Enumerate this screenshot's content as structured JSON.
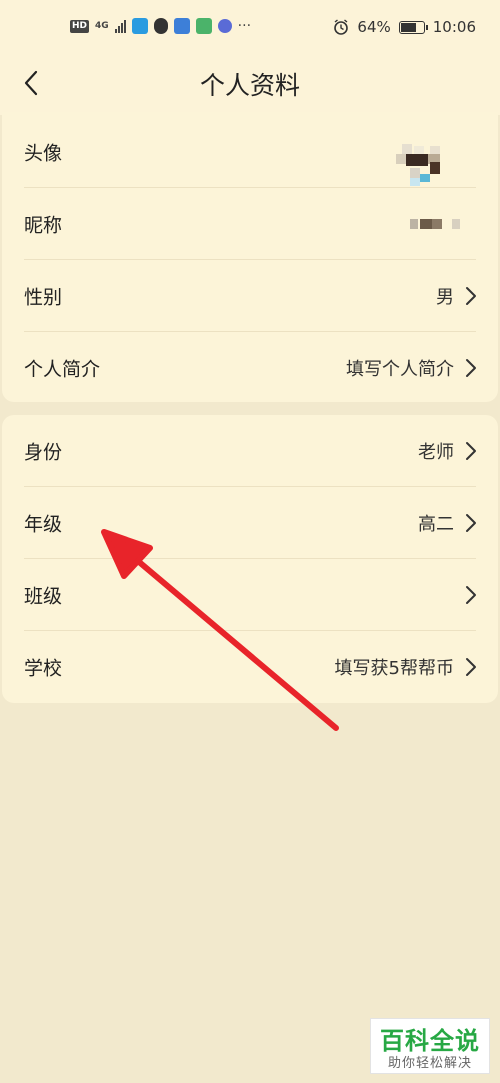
{
  "status_bar": {
    "hd": "HD",
    "network": "4G",
    "battery_pct": "64%",
    "battery_level": 0.64,
    "time": "10:06",
    "more": "···"
  },
  "header": {
    "title": "个人资料"
  },
  "profile_section": {
    "rows": [
      {
        "label": "头像",
        "value": ""
      },
      {
        "label": "昵称",
        "value": ""
      },
      {
        "label": "性别",
        "value": "男"
      },
      {
        "label": "个人简介",
        "value": "填写个人简介"
      }
    ]
  },
  "school_section": {
    "rows": [
      {
        "label": "身份",
        "value": "老师"
      },
      {
        "label": "年级",
        "value": "高二"
      },
      {
        "label": "班级",
        "value": ""
      },
      {
        "label": "学校",
        "value": "填写获5帮帮币"
      }
    ]
  },
  "watermark": {
    "title": "百科全说",
    "subtitle": "助你轻松解决"
  },
  "colors": {
    "background": "#f2e9cd",
    "card": "#fcf4d8",
    "arrow": "#e8242a",
    "watermark_green": "#27a844"
  }
}
